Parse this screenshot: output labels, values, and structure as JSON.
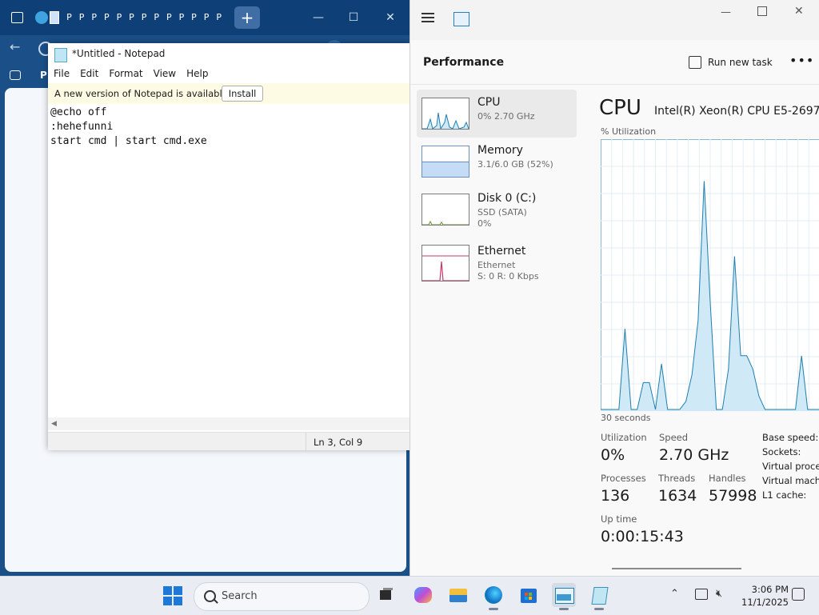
{
  "edge": {
    "tab_letters": [
      "P",
      "P",
      "P",
      "P",
      "P",
      "P",
      "P",
      "P",
      "P",
      "P",
      "P",
      "P",
      "P"
    ],
    "new_tab_symbol": "+",
    "partial_toolbar_label": "P"
  },
  "notepad": {
    "title": "*Untitled - Notepad",
    "menu": [
      "File",
      "Edit",
      "Format",
      "View",
      "Help"
    ],
    "banner_text": "A new version of Notepad is available.",
    "install_label": "Install",
    "lines": [
      "@echo off",
      ":hehefunni",
      "start cmd | start cmd.exe"
    ],
    "status_position": "Ln 3, Col 9"
  },
  "taskmgr": {
    "page_title": "Performance",
    "run_new_task": "Run new task",
    "more_symbol": "•••",
    "sidebar": [
      {
        "name": "CPU",
        "sub1": "0% 2.70 GHz",
        "sub2": ""
      },
      {
        "name": "Memory",
        "sub1": "3.1/6.0 GB (52%)",
        "sub2": ""
      },
      {
        "name": "Disk 0 (C:)",
        "sub1": "SSD (SATA)",
        "sub2": "0%"
      },
      {
        "name": "Ethernet",
        "sub1": "Ethernet",
        "sub2": "S: 0 R: 0 Kbps"
      }
    ],
    "cpu_title": "CPU",
    "cpu_model": "Intel(R) Xeon(R) CPU E5-2697",
    "util_label": "% Utilization",
    "time_label": "30 seconds",
    "stats": {
      "utilization_label": "Utilization",
      "utilization": "0%",
      "speed_label": "Speed",
      "speed": "2.70 GHz",
      "processes_label": "Processes",
      "processes": "136",
      "threads_label": "Threads",
      "threads": "1634",
      "handles_label": "Handles",
      "handles": "57998",
      "uptime_label": "Up time",
      "uptime": "0:00:15:43"
    },
    "right_labels": [
      "Base speed:",
      "Sockets:",
      "Virtual proces",
      "Virtual machi",
      "L1 cache:"
    ],
    "cpu_history": [
      0,
      0,
      0,
      0,
      30,
      0,
      0,
      10,
      10,
      0,
      17,
      0,
      0,
      0,
      3,
      13,
      33,
      85,
      40,
      0,
      0,
      15,
      57,
      20,
      20,
      15,
      5,
      0,
      0,
      0,
      0,
      0,
      0,
      20,
      0,
      0,
      0
    ]
  },
  "taskbar": {
    "search_label": "Search",
    "time": "3:06 PM",
    "date": "11/1/2025",
    "colors": {
      "accent": "#1e78d8",
      "graph_fill": "#cfe9f6",
      "graph_line": "#1f7fb0"
    }
  }
}
